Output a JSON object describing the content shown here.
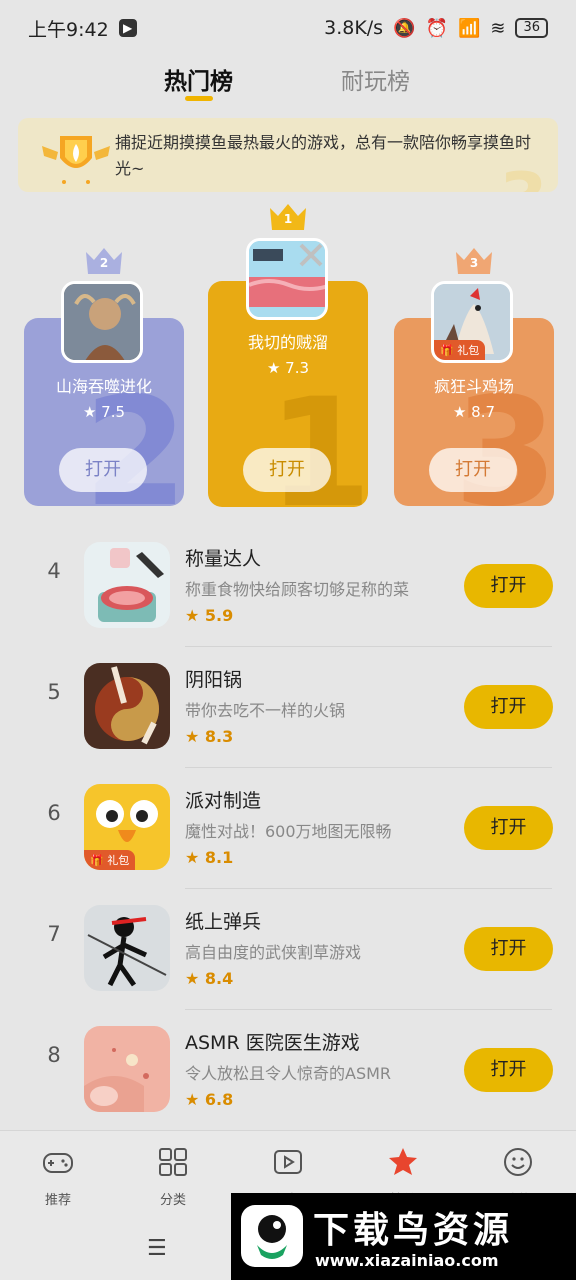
{
  "status": {
    "time": "上午9:42",
    "speed": "3.8K/s",
    "battery": "36"
  },
  "tabs": [
    {
      "label": "热门榜"
    },
    {
      "label": "耐玩榜"
    }
  ],
  "banner": {
    "text": "捕捉近期摸摸鱼最热最火的游戏，总有一款陪你畅享摸鱼时光~"
  },
  "podium": [
    {
      "rank": "1",
      "name": "我切的贼溜",
      "rating": "7.3",
      "button": "打开"
    },
    {
      "rank": "2",
      "name": "山海吞噬进化",
      "rating": "7.5",
      "button": "打开"
    },
    {
      "rank": "3",
      "name": "疯狂斗鸡场",
      "rating": "8.7",
      "button": "打开",
      "badge": "礼包"
    }
  ],
  "list": [
    {
      "rank": "4",
      "title": "称量达人",
      "desc": "称重食物快给顾客切够足称的菜",
      "score": "5.9",
      "button": "打开"
    },
    {
      "rank": "5",
      "title": "阴阳锅",
      "desc": "带你去吃不一样的火锅",
      "score": "8.3",
      "button": "打开"
    },
    {
      "rank": "6",
      "title": "派对制造",
      "desc": "魔性对战！600万地图无限畅",
      "score": "8.1",
      "button": "打开",
      "badge": "礼包"
    },
    {
      "rank": "7",
      "title": "纸上弹兵",
      "desc": "高自由度的武侠割草游戏",
      "score": "8.4",
      "button": "打开"
    },
    {
      "rank": "8",
      "title": "ASMR 医院医生游戏",
      "desc": "令人放松且令人惊奇的ASMR",
      "score": "6.8",
      "button": "打开"
    }
  ],
  "nav": [
    {
      "label": "推荐",
      "icon": "gamepad-icon"
    },
    {
      "label": "分类",
      "icon": "grid-icon"
    },
    {
      "label": "视频",
      "icon": "video-icon"
    },
    {
      "label": "榜单",
      "icon": "star-icon"
    },
    {
      "label": "我的",
      "icon": "smile-icon"
    }
  ],
  "watermark": {
    "title": "下载鸟资源",
    "url": "www.xiazainiao.com"
  },
  "colors": {
    "accent": "#e8b700",
    "gold": "#e8aa13",
    "purple": "#9ba1d8",
    "orange": "#ea9a5e"
  }
}
